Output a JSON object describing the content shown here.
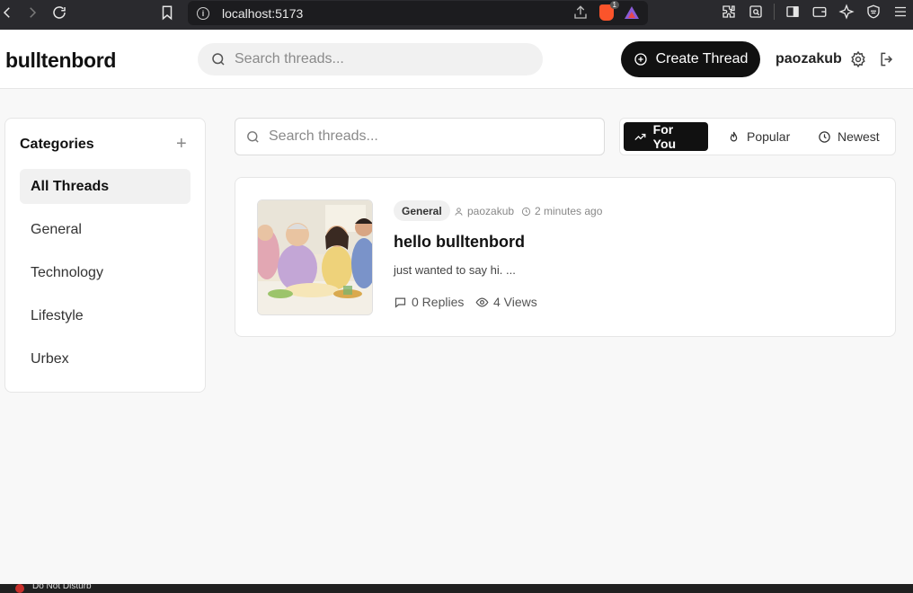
{
  "browser": {
    "url": "localhost:5173",
    "brave_badge_count": "1"
  },
  "header": {
    "logo": "bulltenbord",
    "search_placeholder": "Search threads...",
    "create_label": "Create Thread",
    "username": "paozakub"
  },
  "sidebar": {
    "title": "Categories",
    "items": [
      {
        "label": "All Threads",
        "active": true
      },
      {
        "label": "General"
      },
      {
        "label": "Technology"
      },
      {
        "label": "Lifestyle"
      },
      {
        "label": "Urbex"
      }
    ]
  },
  "main": {
    "search_placeholder": "Search threads...",
    "sort_tabs": [
      {
        "label": "For You",
        "active": true,
        "icon": "trending-up-icon"
      },
      {
        "label": "Popular",
        "icon": "flame-icon"
      },
      {
        "label": "Newest",
        "icon": "clock-icon"
      }
    ],
    "threads": [
      {
        "category": "General",
        "author": "paozakub",
        "time": "2 minutes ago",
        "title": "hello bulltenbord",
        "excerpt": "just wanted to say hi. ...",
        "replies": "0 Replies",
        "views": "4 Views"
      }
    ]
  },
  "taskbar": {
    "status": "Do Not Disturb"
  }
}
